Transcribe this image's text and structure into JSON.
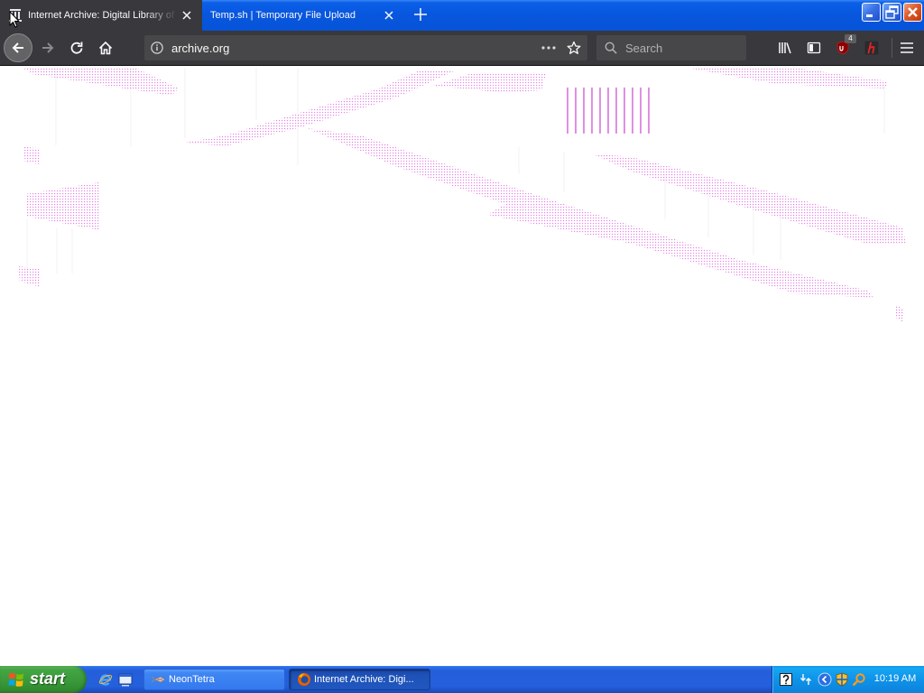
{
  "window": {
    "controls": [
      "minimize-icon",
      "restore-icon",
      "close-icon"
    ]
  },
  "browser": {
    "tabs": [
      {
        "label": "Internet Archive: Digital Library of",
        "icon": "archive-favicon-icon",
        "active": true
      },
      {
        "label": "Temp.sh | Temporary File Upload",
        "active": false
      }
    ],
    "toolbar": {
      "nav_buttons": [
        "back-icon",
        "forward-icon",
        "reload-icon",
        "home-icon"
      ],
      "url": "archive.org",
      "url_icons": [
        "info-icon",
        "page-actions-icon",
        "bookmark-star-icon"
      ],
      "search_placeholder": "Search",
      "extension_icons": [
        "library-icon",
        "sidebar-icon",
        "ublock-origin-icon",
        "h-extension-icon",
        "menu-icon"
      ],
      "ublock_badge": "4"
    }
  },
  "taskbar": {
    "start_label": "start",
    "quick_launch": [
      "internet-explorer-icon",
      "show-desktop-icon"
    ],
    "buttons": [
      {
        "label": "NeonTetra",
        "icon": "neontetra-app-icon",
        "active": false
      },
      {
        "label": "Internet Archive: Digi...",
        "icon": "firefox-icon",
        "active": true
      }
    ],
    "tray_icons": [
      "help-icon",
      "sync-arrows-icon",
      "show-hidden-icons-icon",
      "security-shield-icon",
      "orange-magnifier-icon"
    ],
    "clock": "10:19 AM"
  },
  "colors": {
    "chrome_dark": "#38383d",
    "urlbar_bg": "#474749",
    "text_light": "#f9f9fa",
    "text_muted": "#b1b1b3",
    "xp_title_blue": "#0857de",
    "xp_taskbar_blue": "#245edb",
    "xp_start_green": "#3a9a3a",
    "xp_tray_blue": "#0f93e9",
    "artifact_magenta": "#d040d0"
  }
}
